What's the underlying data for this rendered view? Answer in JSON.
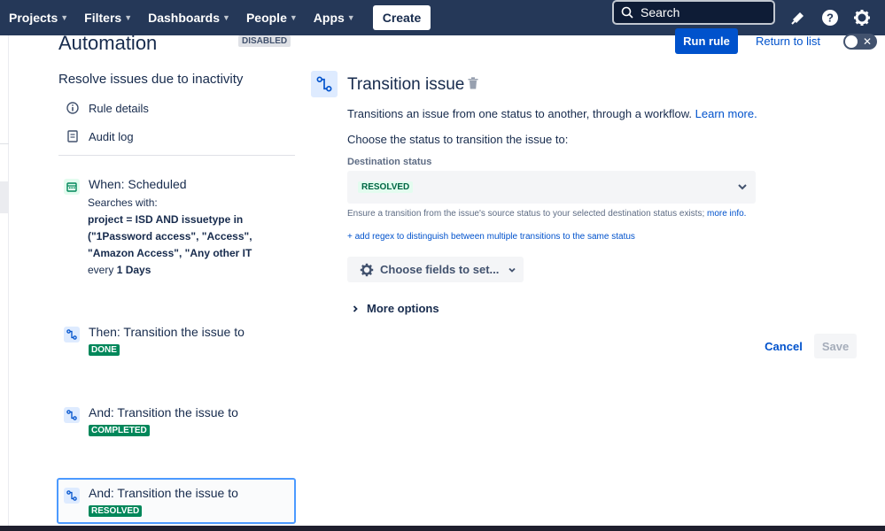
{
  "topnav": {
    "items": [
      {
        "label": "Projects"
      },
      {
        "label": "Filters"
      },
      {
        "label": "Dashboards"
      },
      {
        "label": "People"
      },
      {
        "label": "Apps"
      }
    ],
    "create_label": "Create",
    "search_placeholder": "Search",
    "icons": [
      "notifications-icon",
      "help-icon",
      "settings-icon"
    ]
  },
  "header": {
    "title": "Automation",
    "status_badge": "DISABLED",
    "run_rule_label": "Run rule",
    "return_label": "Return to list"
  },
  "rule": {
    "name": "Resolve issues due to inactivity",
    "links": [
      {
        "label": "Rule details",
        "icon": "info-icon"
      },
      {
        "label": "Audit log",
        "icon": "document-icon"
      }
    ]
  },
  "steps": {
    "trigger": {
      "title": "When: Scheduled",
      "searches_label": "Searches with:",
      "jql_lines": [
        "project = ISD AND issuetype in",
        "(\"1Password access\", \"Access\",",
        "\"Amazon Access\", \"Any other IT"
      ],
      "every_prefix": "every",
      "every_value": "1 Days"
    },
    "actions": [
      {
        "title": "Then: Transition the issue to",
        "badge": "DONE"
      },
      {
        "title": "And: Transition the issue to",
        "badge": "COMPLETED"
      },
      {
        "title": "And: Transition the issue to",
        "badge": "RESOLVED"
      }
    ]
  },
  "panel": {
    "title": "Transition issue",
    "description": "Transitions an issue from one status to another, through a workflow.",
    "learn_more": "Learn more.",
    "choose_text": "Choose the status to transition the issue to:",
    "destination_label": "Destination status",
    "destination_value": "RESOLVED",
    "hint": "Ensure a transition from the issue's source status to your selected destination status exists;",
    "hint_link": "more info.",
    "regex_link": "+ add regex to distinguish between multiple transitions to the same status",
    "fields_button": "Choose fields to set...",
    "more_options": "More options",
    "cancel_label": "Cancel",
    "save_label": "Save"
  },
  "colors": {
    "nav_bg": "#253858",
    "primary": "#0052cc",
    "success": "#00875a",
    "selected_border": "#4c9aff"
  }
}
